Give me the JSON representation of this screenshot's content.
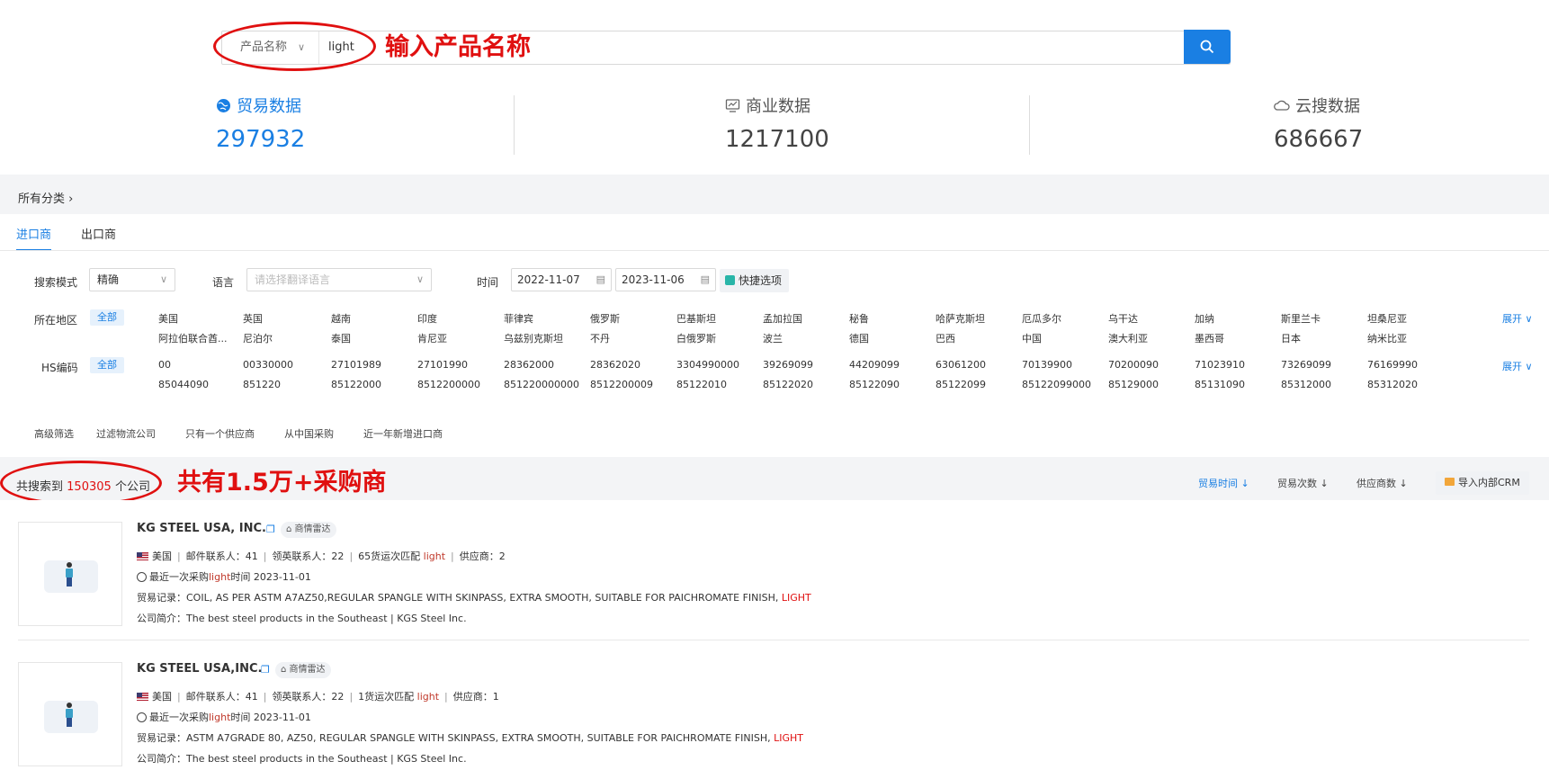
{
  "search": {
    "category_label": "产品名称",
    "query": "light",
    "annotation": "输入产品名称"
  },
  "stats": [
    {
      "label": "贸易数据",
      "value": "297932",
      "icon": "globe-icon"
    },
    {
      "label": "商业数据",
      "value": "1217100",
      "icon": "chart-monitor-icon"
    },
    {
      "label": "云搜数据",
      "value": "686667",
      "icon": "cloud-icon"
    }
  ],
  "breadcrumb": "所有分类 ›",
  "tabs": [
    "进口商",
    "出口商"
  ],
  "filters": {
    "mode_label": "搜索模式",
    "mode_value": "精确",
    "lang_label": "语言",
    "lang_placeholder": "请选择翻译语言",
    "time_label": "时间",
    "date_from": "2022-11-07",
    "date_to": "2023-11-06",
    "quick_label": "快捷选项",
    "region_label": "所在地区",
    "all_label": "全部",
    "expand_label": "展开 ∨",
    "regions_row1": [
      "美国",
      "英国",
      "越南",
      "印度",
      "菲律宾",
      "俄罗斯",
      "巴基斯坦",
      "孟加拉国",
      "秘鲁",
      "哈萨克斯坦",
      "厄瓜多尔",
      "乌干达",
      "加纳",
      "斯里兰卡",
      "坦桑尼亚"
    ],
    "regions_row2": [
      "阿拉伯联合酋...",
      "尼泊尔",
      "泰国",
      "肯尼亚",
      "乌兹别克斯坦",
      "不丹",
      "白俄罗斯",
      "波兰",
      "德国",
      "巴西",
      "中国",
      "澳大利亚",
      "墨西哥",
      "日本",
      "纳米比亚"
    ],
    "hs_label": "HS编码",
    "hs_row1": [
      "00",
      "00330000",
      "27101989",
      "27101990",
      "28362000",
      "28362020",
      "3304990000",
      "39269099",
      "44209099",
      "63061200",
      "70139900",
      "70200090",
      "71023910",
      "73269099",
      "76169990"
    ],
    "hs_row2": [
      "85044090",
      "851220",
      "85122000",
      "8512200000",
      "851220000000",
      "8512200009",
      "85122010",
      "85122020",
      "85122090",
      "85122099",
      "85122099000",
      "85129000",
      "85131090",
      "85312000",
      "85312020"
    ],
    "advanced": [
      "高级筛选",
      "过滤物流公司",
      "只有一个供应商",
      "从中国采购",
      "近一年新增进口商"
    ]
  },
  "results": {
    "prefix": "共搜索到",
    "count": "150305",
    "suffix": "个公司",
    "annotation": "共有1.5万+采购商",
    "sorts": [
      "贸易时间 ↓",
      "贸易次数 ↓",
      "供应商数 ↓"
    ],
    "crm_label": "导入内部CRM",
    "items": [
      {
        "name": "KG STEEL USA, INC.",
        "radar": "商情雷达",
        "country": "美国",
        "mail_contacts": "邮件联系人：41",
        "linkedin_contacts": "领英联系人：22",
        "shipments_pre": "65货运次匹配",
        "keyword": "light",
        "suppliers": "供应商：2",
        "last_purchase_pre": "最近一次采购",
        "last_purchase_post": "时间 2023-11-01",
        "trade_label": "贸易记录：",
        "trade_text": "COIL, AS PER ASTM A7AZ50,REGULAR SPANGLE WITH SKINPASS, EXTRA SMOOTH, SUITABLE FOR PAICHROMATE FINISH,",
        "trade_kw": "LIGHT",
        "intro": "公司简介：The best steel products in the Southeast | KGS Steel Inc."
      },
      {
        "name": "KG STEEL USA,INC.",
        "radar": "商情雷达",
        "country": "美国",
        "mail_contacts": "邮件联系人：41",
        "linkedin_contacts": "领英联系人：22",
        "shipments_pre": "1货运次匹配",
        "keyword": "light",
        "suppliers": "供应商：1",
        "last_purchase_pre": "最近一次采购",
        "last_purchase_post": "时间 2023-11-01",
        "trade_label": "贸易记录：",
        "trade_text": "ASTM A7GRADE 80, AZ50, REGULAR SPANGLE WITH SKINPASS, EXTRA SMOOTH, SUITABLE FOR PAICHROMATE FINISH,",
        "trade_kw": "LIGHT",
        "intro": "公司简介：The best steel products in the Southeast | KGS Steel Inc."
      }
    ]
  },
  "colors": {
    "accent": "#1a7fe3",
    "annotation": "#e01010"
  }
}
